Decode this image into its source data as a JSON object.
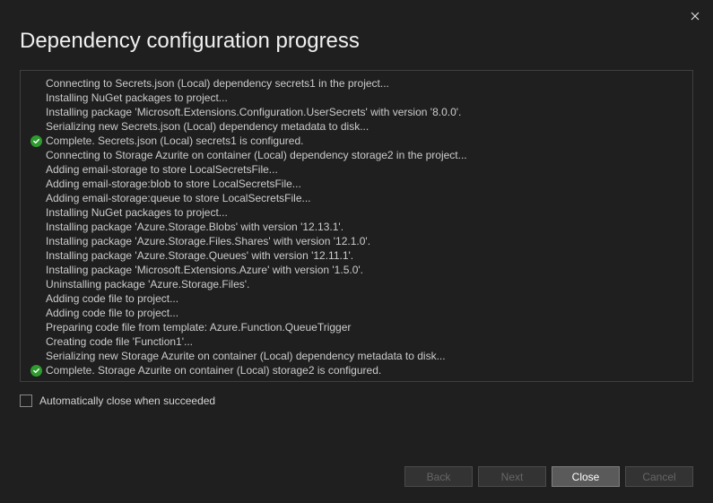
{
  "title": "Dependency configuration progress",
  "log": [
    {
      "icon": null,
      "text": "Connecting to Secrets.json (Local) dependency secrets1 in the project..."
    },
    {
      "icon": null,
      "text": "Installing NuGet packages to project..."
    },
    {
      "icon": null,
      "text": "Installing package 'Microsoft.Extensions.Configuration.UserSecrets' with version '8.0.0'."
    },
    {
      "icon": null,
      "text": "Serializing new Secrets.json (Local) dependency metadata to disk..."
    },
    {
      "icon": "success",
      "text": "Complete. Secrets.json (Local) secrets1 is configured."
    },
    {
      "icon": null,
      "text": "Connecting to Storage Azurite on container (Local) dependency storage2 in the project..."
    },
    {
      "icon": null,
      "text": "Adding email-storage to store LocalSecretsFile..."
    },
    {
      "icon": null,
      "text": "Adding email-storage:blob to store LocalSecretsFile..."
    },
    {
      "icon": null,
      "text": "Adding email-storage:queue to store LocalSecretsFile..."
    },
    {
      "icon": null,
      "text": "Installing NuGet packages to project..."
    },
    {
      "icon": null,
      "text": "Installing package 'Azure.Storage.Blobs' with version '12.13.1'."
    },
    {
      "icon": null,
      "text": "Installing package 'Azure.Storage.Files.Shares' with version '12.1.0'."
    },
    {
      "icon": null,
      "text": "Installing package 'Azure.Storage.Queues' with version '12.11.1'."
    },
    {
      "icon": null,
      "text": "Installing package 'Microsoft.Extensions.Azure' with version '1.5.0'."
    },
    {
      "icon": null,
      "text": "Uninstalling package 'Azure.Storage.Files'."
    },
    {
      "icon": null,
      "text": "Adding code file to project..."
    },
    {
      "icon": null,
      "text": "Adding code file to project..."
    },
    {
      "icon": null,
      "text": "Preparing code file from template: Azure.Function.QueueTrigger"
    },
    {
      "icon": null,
      "text": "Creating code file 'Function1'..."
    },
    {
      "icon": null,
      "text": "Serializing new Storage Azurite on container (Local) dependency metadata to disk..."
    },
    {
      "icon": "success",
      "text": "Complete. Storage Azurite on container (Local) storage2 is configured."
    }
  ],
  "checkbox": {
    "label": "Automatically close when succeeded",
    "checked": false
  },
  "buttons": {
    "back": "Back",
    "next": "Next",
    "close": "Close",
    "cancel": "Cancel"
  }
}
